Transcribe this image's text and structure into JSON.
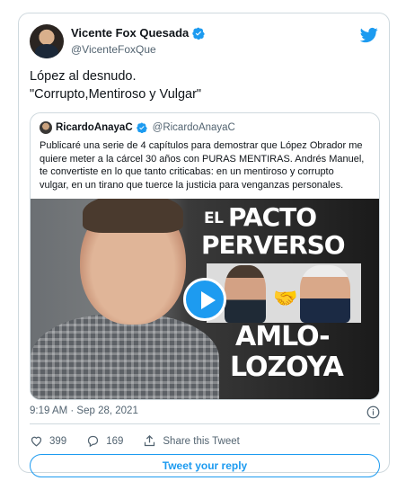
{
  "author": {
    "name": "Vicente Fox Quesada",
    "handle": "@VicenteFoxQue"
  },
  "tweet": {
    "lines": [
      "López al desnudo.",
      "\"Corrupto,Mentiroso y Vulgar\""
    ]
  },
  "quoted": {
    "name": "RicardoAnayaC",
    "handle": "@RicardoAnayaC",
    "lines": [
      "Publicaré una serie de 4 capítulos para demostrar que López Obrador me",
      "quiere meter a la cárcel 30 años con PURAS MENTIRAS. Andrés Manuel,",
      "te convertiste en lo que tanto criticabas: en un mentiroso y corrupto",
      "vulgar, en un tirano que tuerce la justicia para venganzas personales."
    ],
    "media": {
      "title_el": "EL",
      "title_pacto": "PACTO",
      "title_perverso": "PERVERSO",
      "title_amlo": "AMLO-",
      "title_lozoya": "LOZOYA"
    }
  },
  "meta": {
    "timestamp": "9:19 AM · Sep 28, 2021"
  },
  "actions": {
    "likes": "399",
    "replies": "169",
    "share_label": "Share this Tweet"
  },
  "reply_button": "Tweet your reply",
  "colors": {
    "accent": "#1d9bf0",
    "text": "#0f1419",
    "secondary": "#536471",
    "border": "#cfd9de"
  }
}
